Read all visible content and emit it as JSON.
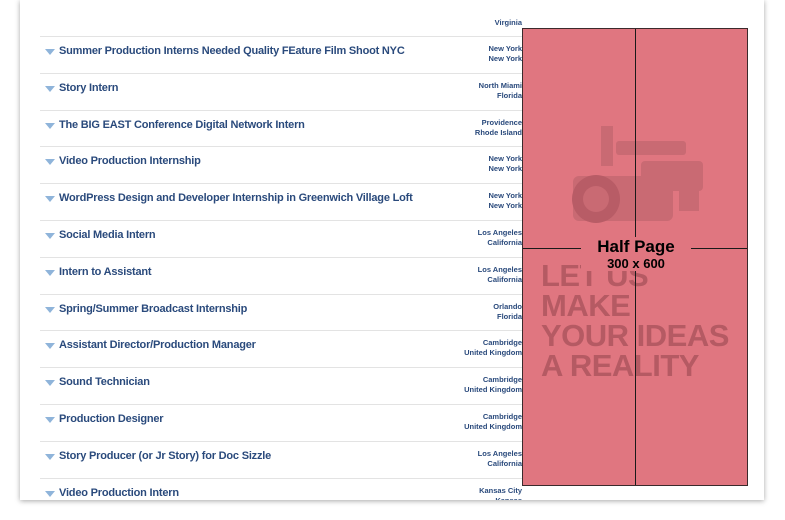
{
  "top_location": "Virginia",
  "jobs": [
    {
      "title": "Summer Production Interns Needed Quality FEature Film Shoot NYC",
      "city": "New York",
      "region": "New York"
    },
    {
      "title": "Story Intern",
      "city": "North Miami",
      "region": "Florida"
    },
    {
      "title": "The BIG EAST Conference Digital Network Intern",
      "city": "Providence",
      "region": "Rhode Island"
    },
    {
      "title": "Video Production Internship",
      "city": "New York",
      "region": "New York"
    },
    {
      "title": "WordPress Design and Developer Internship in Greenwich Village Loft",
      "city": "New York",
      "region": "New York"
    },
    {
      "title": "Social Media Intern",
      "city": "Los Angeles",
      "region": "California"
    },
    {
      "title": "Intern to Assistant",
      "city": "Los Angeles",
      "region": "California"
    },
    {
      "title": "Spring/Summer Broadcast Internship",
      "city": "Orlando",
      "region": "Florida"
    },
    {
      "title": "Assistant Director/Production Manager",
      "city": "Cambridge",
      "region": "United Kingdom"
    },
    {
      "title": "Sound Technician",
      "city": "Cambridge",
      "region": "United Kingdom"
    },
    {
      "title": "Production Designer",
      "city": "Cambridge",
      "region": "United Kingdom"
    },
    {
      "title": "Story Producer (or Jr Story) for Doc Sizzle",
      "city": "Los Angeles",
      "region": "California"
    },
    {
      "title": "Video Production Intern",
      "city": "Kansas City",
      "region": "Kansas"
    }
  ],
  "ad": {
    "size_label": "Half Page",
    "dimensions": "300 x 600",
    "tagline": [
      "LET US MAKE",
      "YOUR IDEAS",
      "A REALITY"
    ],
    "bg_color": "#e07680"
  },
  "colors": {
    "link": "#2a4a7c",
    "caret": "#8fb4da"
  }
}
